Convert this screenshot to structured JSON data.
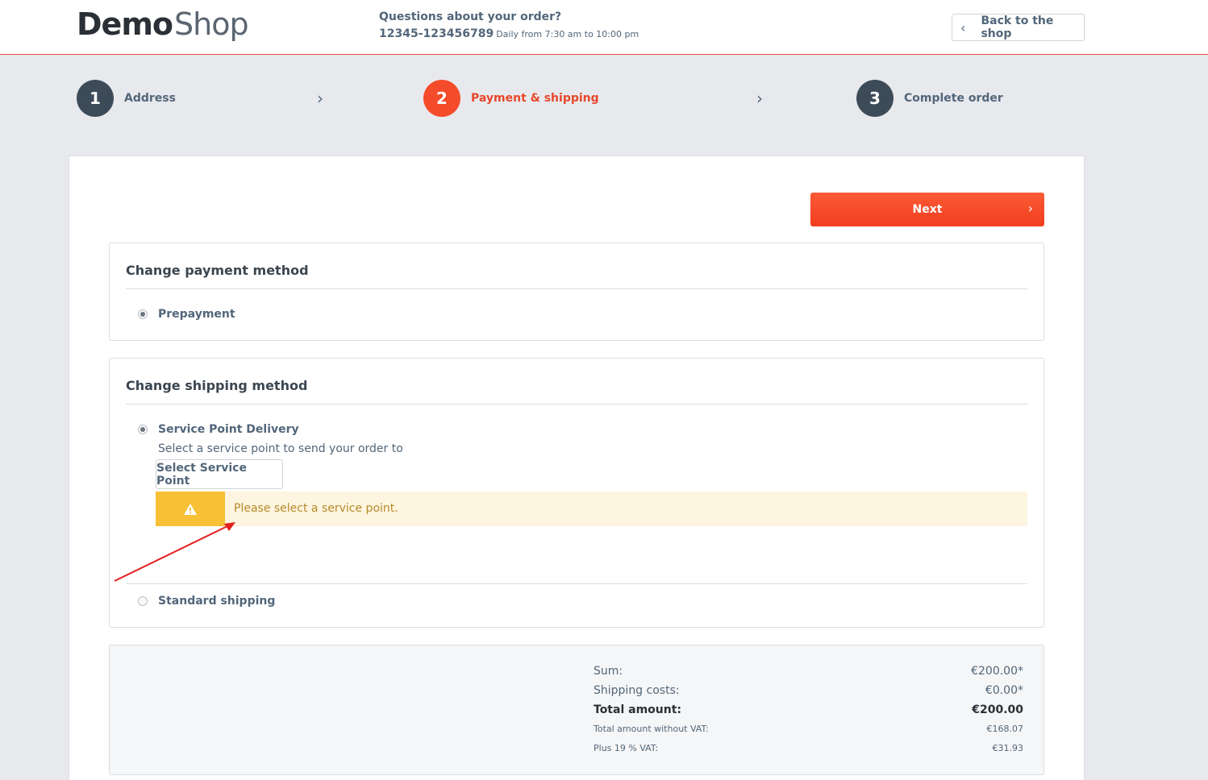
{
  "header": {
    "logo_part1": "Demo",
    "logo_part2": "Shop",
    "contact_question": "Questions about your order?",
    "contact_phone": "12345-123456789",
    "contact_hours": "Daily from 7:30 am to 10:00 pm",
    "back_label": "Back to the shop"
  },
  "steps": [
    {
      "number": "1",
      "label": "Address"
    },
    {
      "number": "2",
      "label": "Payment & shipping"
    },
    {
      "number": "3",
      "label": "Complete order"
    }
  ],
  "next_label": "Next",
  "payment": {
    "title": "Change payment method",
    "options": [
      {
        "label": "Prepayment",
        "selected": true
      }
    ]
  },
  "shipping": {
    "title": "Change shipping method",
    "options": [
      {
        "label": "Service Point Delivery",
        "selected": true
      },
      {
        "label": "Standard shipping",
        "selected": false
      }
    ],
    "service_point_hint": "Select a service point to send your order to",
    "select_button": "Select Service Point",
    "alert_message": "Please select a service point."
  },
  "summary": {
    "sum_label": "Sum:",
    "sum_value": "€200.00*",
    "shipping_label": "Shipping costs:",
    "shipping_value": "€0.00*",
    "total_label": "Total amount:",
    "total_value": "€200.00",
    "net_label": "Total amount without VAT:",
    "net_value": "€168.07",
    "vat_label": "Plus 19 % VAT:",
    "vat_value": "€31.93"
  },
  "colors": {
    "accent": "#f44b2a",
    "step_inactive": "#3d4b59",
    "warning": "#f7c036",
    "annotation_arrow": "#e31e1e"
  }
}
